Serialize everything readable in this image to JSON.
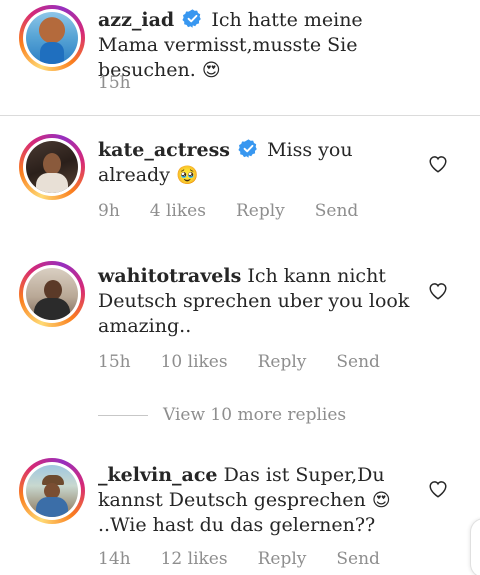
{
  "comments": [
    {
      "username": "azz_iad",
      "verified": true,
      "text": "Ich hatte meine Mama vermisst,musste Sie besuchen.",
      "emoji": "😍",
      "time": "15h"
    },
    {
      "username": "kate_actress",
      "verified": true,
      "text": "Miss you already",
      "emoji": "🥹",
      "time": "9h",
      "likes": "4 likes",
      "reply_label": "Reply",
      "send_label": "Send"
    },
    {
      "username": "wahitotravels",
      "verified": false,
      "text": "Ich kann nicht Deutsch sprechen uber you look amazing..",
      "time": "15h",
      "likes": "10 likes",
      "reply_label": "Reply",
      "send_label": "Send"
    },
    {
      "username": "_kelvin_ace",
      "verified": false,
      "text_before_emoji": "Das ist Super,Du kannst Deutsch gesprechen",
      "emoji": "😍",
      "text_after_emoji": "..Wie hast du das gelernen??",
      "time": "14h",
      "likes": "12 likes",
      "reply_label": "Reply",
      "send_label": "Send"
    }
  ],
  "view_more_replies": "View 10 more replies",
  "colors": {
    "text": "#262626",
    "muted": "#8e8e8e",
    "verified_blue": "#3897f0",
    "divider": "#dbdbdb"
  },
  "icons": {
    "verified": "verified-badge-icon",
    "like": "heart-icon"
  }
}
